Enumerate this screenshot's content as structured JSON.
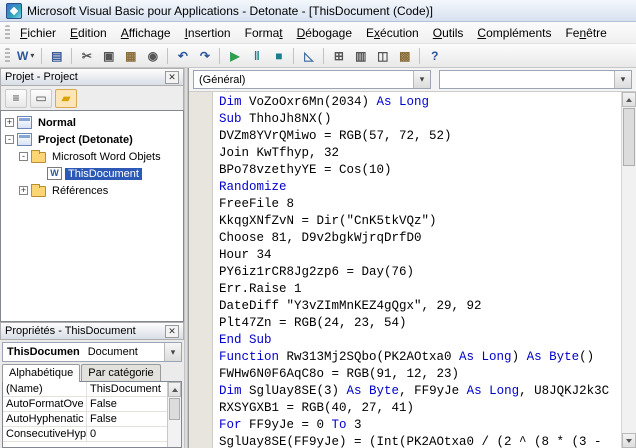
{
  "colors": {
    "keyword": "#0000CC",
    "selection": "#2C59B5",
    "run_green": "#2E9E4F",
    "debug_teal": "#1B7E8F"
  },
  "window": {
    "title": "Microsoft Visual Basic pour Applications - Detonate - [ThisDocument (Code)]"
  },
  "menu": {
    "items": [
      {
        "label": "Fichier",
        "u": 0
      },
      {
        "label": "Edition",
        "u": 0
      },
      {
        "label": "Affichage",
        "u": 0
      },
      {
        "label": "Insertion",
        "u": 0
      },
      {
        "label": "Format",
        "u": 5
      },
      {
        "label": "Débogage",
        "u": 0
      },
      {
        "label": "Exécution",
        "u": 1
      },
      {
        "label": "Outils",
        "u": 0
      },
      {
        "label": "Compléments",
        "u": 0
      },
      {
        "label": "Fenêtre",
        "u": 2
      }
    ]
  },
  "toolbar": {
    "buttons": [
      {
        "name": "view-microsoft-word-button",
        "glyph": "W",
        "color": "#2B579A",
        "arrow": true
      },
      {
        "sep": true
      },
      {
        "name": "save-button",
        "glyph": "▤",
        "color": "#3C5A99"
      },
      {
        "sep": true
      },
      {
        "name": "cut-button",
        "glyph": "✂",
        "color": "#555555"
      },
      {
        "name": "copy-button",
        "glyph": "▣",
        "color": "#555555"
      },
      {
        "name": "paste-button",
        "glyph": "▦",
        "color": "#8A6D3B"
      },
      {
        "name": "find-button",
        "glyph": "◉",
        "color": "#555555"
      },
      {
        "sep": true
      },
      {
        "name": "undo-button",
        "glyph": "↶",
        "color": "#2B579A"
      },
      {
        "name": "redo-button",
        "glyph": "↷",
        "color": "#2B579A"
      },
      {
        "sep": true
      },
      {
        "name": "run-button",
        "glyph": "▶",
        "color": "#2E9E4F"
      },
      {
        "name": "break-button",
        "glyph": "‖",
        "color": "#1B7E8F"
      },
      {
        "name": "reset-button",
        "glyph": "■",
        "color": "#1B7E8F"
      },
      {
        "sep": true
      },
      {
        "name": "design-mode-button",
        "glyph": "◺",
        "color": "#3C6EA5"
      },
      {
        "sep": true
      },
      {
        "name": "project-explorer-button",
        "glyph": "⊞",
        "color": "#555555"
      },
      {
        "name": "properties-window-button",
        "glyph": "▥",
        "color": "#555555"
      },
      {
        "name": "object-browser-button",
        "glyph": "◫",
        "color": "#555555"
      },
      {
        "name": "toolbox-button",
        "glyph": "▩",
        "color": "#8A6D3B"
      },
      {
        "sep": true
      },
      {
        "name": "help-button",
        "glyph": "?",
        "color": "#2B579A"
      }
    ]
  },
  "project_panel": {
    "title": "Projet - Project",
    "close_label": "✕",
    "buttons": [
      {
        "name": "view-code-button",
        "glyph": "≡",
        "color": "#4A4A4A"
      },
      {
        "name": "view-object-button",
        "glyph": "▭",
        "color": "#4A4A4A"
      },
      {
        "name": "toggle-folders-button",
        "glyph": "▰",
        "color": "#D8A200",
        "active": true
      }
    ],
    "tree": [
      {
        "label": "Normal",
        "indent": 0,
        "exp": "+",
        "icon": "project",
        "bold": true
      },
      {
        "label": "Project (Detonate)",
        "indent": 0,
        "exp": "-",
        "icon": "project",
        "bold": true
      },
      {
        "label": "Microsoft Word Objets",
        "indent": 1,
        "exp": "-",
        "icon": "folder"
      },
      {
        "label": "ThisDocument",
        "indent": 2,
        "icon": "worddoc",
        "glyph": "W",
        "selected": true
      },
      {
        "label": "Références",
        "indent": 1,
        "exp": "+",
        "icon": "folder"
      }
    ]
  },
  "properties_panel": {
    "title": "Propriétés - ThisDocument",
    "close_label": "✕",
    "object_name": "ThisDocumen",
    "object_type": "Document",
    "tabs": [
      "Alphabétique",
      "Par catégorie"
    ],
    "rows": [
      {
        "name": "(Name)",
        "value": "ThisDocument"
      },
      {
        "name": "AutoFormatOve",
        "value": "False"
      },
      {
        "name": "AutoHyphenatic",
        "value": "False"
      },
      {
        "name": "ConsecutiveHyp",
        "value": "0"
      }
    ]
  },
  "code": {
    "left_combo": "(Général)",
    "right_combo": "",
    "lines": [
      [
        [
          1,
          "Dim"
        ],
        [
          0,
          " VoZoOxr6Mn(2034) "
        ],
        [
          1,
          "As Long"
        ]
      ],
      [
        [
          1,
          "Sub"
        ],
        [
          0,
          " ThhoJh8NX()"
        ]
      ],
      [
        [
          0,
          "DVZm8YVrQMiwo = RGB(57, 72, 52)"
        ]
      ],
      [
        [
          0,
          "Join KwTfhyp, 32"
        ]
      ],
      [
        [
          0,
          "BPo78vzethyYE = Cos(10)"
        ]
      ],
      [
        [
          1,
          "Randomize"
        ]
      ],
      [
        [
          0,
          "FreeFile 8"
        ]
      ],
      [
        [
          0,
          "KkqgXNfZvN = Dir(\"CnK5tkVQz\")"
        ]
      ],
      [
        [
          0,
          "Choose 81, D9v2bgkWjrqDrfD0"
        ]
      ],
      [
        [
          0,
          "Hour 34"
        ]
      ],
      [
        [
          0,
          "PY6iz1rCR8Jg2zp6 = Day(76)"
        ]
      ],
      [
        [
          0,
          "Err.Raise 1"
        ]
      ],
      [
        [
          0,
          "DateDiff \"Y3vZImMnKEZ4gQgx\", 29, 92"
        ]
      ],
      [
        [
          0,
          "Plt47Zn = RGB(24, 23, 54)"
        ]
      ],
      [
        [
          1,
          "End Sub"
        ]
      ],
      [
        [
          1,
          "Function"
        ],
        [
          0,
          " Rw313Mj2SQbo(PK2AOtxa0 "
        ],
        [
          1,
          "As Long"
        ],
        [
          0,
          ") "
        ],
        [
          1,
          "As Byte"
        ],
        [
          0,
          "()"
        ]
      ],
      [
        [
          0,
          "FWHw6N0F6AqC8o = RGB(91, 12, 23)"
        ]
      ],
      [
        [
          1,
          "Dim"
        ],
        [
          0,
          " SglUay8SE(3) "
        ],
        [
          1,
          "As Byte"
        ],
        [
          0,
          ", FF9yJe "
        ],
        [
          1,
          "As Long"
        ],
        [
          0,
          ", U8JQKJ2k3C"
        ]
      ],
      [
        [
          0,
          "RXSYGXB1 = RGB(40, 27, 41)"
        ]
      ],
      [
        [
          1,
          "For"
        ],
        [
          0,
          " FF9yJe = 0 "
        ],
        [
          1,
          "To"
        ],
        [
          0,
          " 3"
        ]
      ],
      [
        [
          0,
          "SglUay8SE(FF9yJe) = (Int(PK2AOtxa0 / (2 ^ (8 * (3 -"
        ]
      ]
    ]
  }
}
